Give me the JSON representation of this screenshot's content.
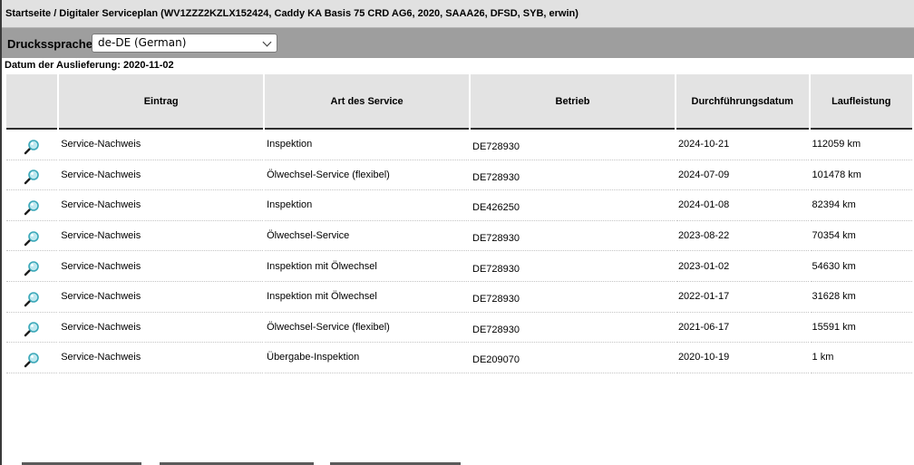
{
  "breadcrumb": "Startseite / Digitaler Serviceplan (WV1ZZZ2KZLX152424, Caddy KA Basis 75 CRD AG6, 2020, SAAA26, DFSD, SYB, erwin)",
  "language": {
    "label": "Druckssprache:",
    "selected": "de-DE (German)"
  },
  "delivery_date": "Datum der Auslieferung: 2020-11-02",
  "table": {
    "columns": [
      "",
      "Eintrag",
      "Art des Service",
      "Betrieb",
      "Durchführungsdatum",
      "Laufleistung"
    ],
    "rows": [
      {
        "icon": "magnifier-icon",
        "eintrag": "Service-Nachweis",
        "art": "Inspektion",
        "betrieb": "DE728930",
        "datum": "2024-10-21",
        "laufleistung": "112059 km"
      },
      {
        "icon": "magnifier-icon",
        "eintrag": "Service-Nachweis",
        "art": "Ölwechsel-Service (flexibel)",
        "betrieb": "DE728930",
        "datum": "2024-07-09",
        "laufleistung": "101478 km"
      },
      {
        "icon": "magnifier-icon",
        "eintrag": "Service-Nachweis",
        "art": "Inspektion",
        "betrieb": "DE426250",
        "datum": "2024-01-08",
        "laufleistung": "82394 km"
      },
      {
        "icon": "magnifier-icon",
        "eintrag": "Service-Nachweis",
        "art": "Ölwechsel-Service",
        "betrieb": "DE728930",
        "datum": "2023-08-22",
        "laufleistung": "70354 km"
      },
      {
        "icon": "magnifier-icon",
        "eintrag": "Service-Nachweis",
        "art": "Inspektion mit Ölwechsel",
        "betrieb": "DE728930",
        "datum": "2023-01-02",
        "laufleistung": "54630 km"
      },
      {
        "icon": "magnifier-icon",
        "eintrag": "Service-Nachweis",
        "art": "Inspektion mit Ölwechsel",
        "betrieb": "DE728930",
        "datum": "2022-01-17",
        "laufleistung": "31628 km"
      },
      {
        "icon": "magnifier-icon",
        "eintrag": "Service-Nachweis",
        "art": "Ölwechsel-Service (flexibel)",
        "betrieb": "DE728930",
        "datum": "2021-06-17",
        "laufleistung": "15591 km"
      },
      {
        "icon": "magnifier-icon",
        "eintrag": "Service-Nachweis",
        "art": "Übergabe-Inspektion",
        "betrieb": "DE209070",
        "datum": "2020-10-19",
        "laufleistung": "1 km"
      }
    ]
  },
  "colors": {
    "header_bg": "#e3e3e3",
    "toolbar_bg": "#9e9e9e",
    "icon_teal": "#3aa7b8"
  }
}
